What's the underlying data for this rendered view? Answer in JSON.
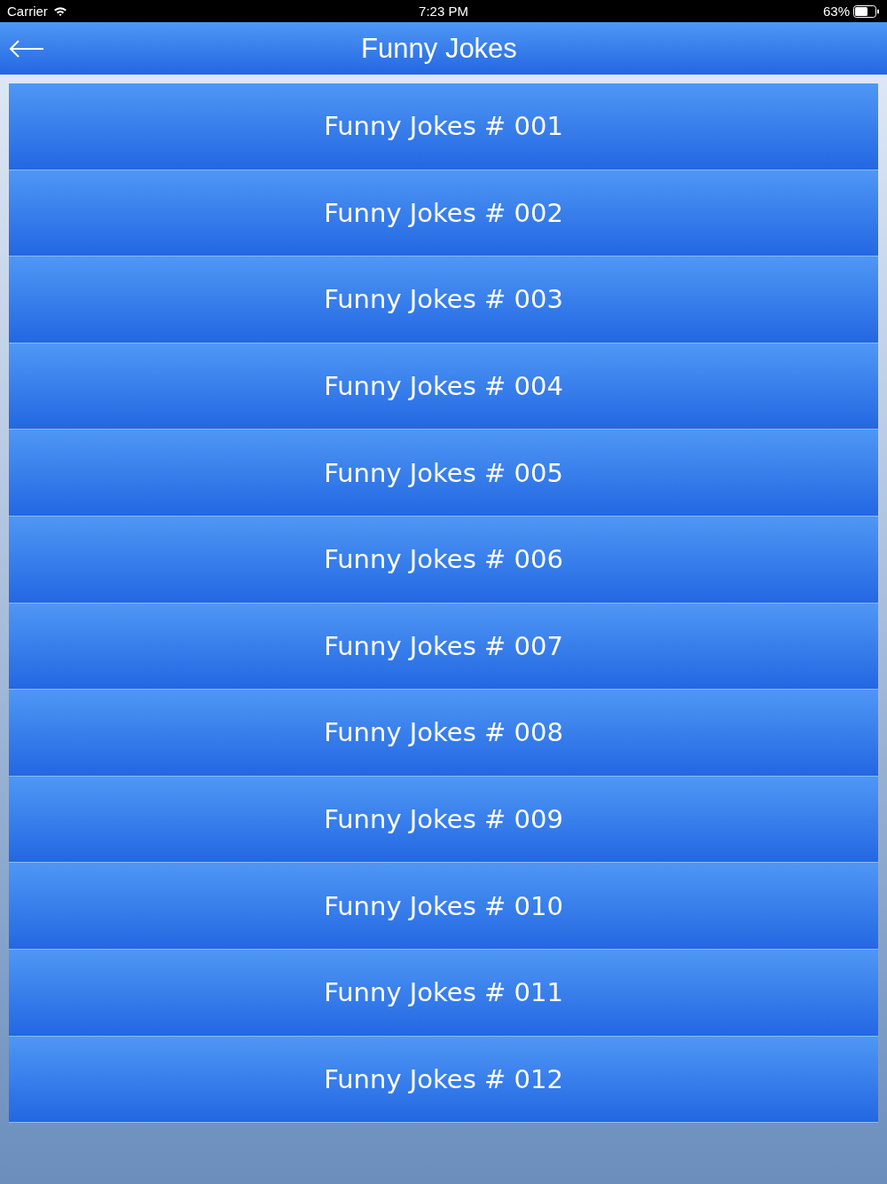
{
  "status_bar": {
    "carrier": "Carrier",
    "time": "7:23 PM",
    "battery": "63%"
  },
  "nav_bar": {
    "title": "Funny Jokes"
  },
  "jokes": [
    {
      "label": "Funny Jokes # 001"
    },
    {
      "label": "Funny Jokes # 002"
    },
    {
      "label": "Funny Jokes # 003"
    },
    {
      "label": "Funny Jokes # 004"
    },
    {
      "label": "Funny Jokes # 005"
    },
    {
      "label": "Funny Jokes # 006"
    },
    {
      "label": "Funny Jokes # 007"
    },
    {
      "label": "Funny Jokes # 008"
    },
    {
      "label": "Funny Jokes # 009"
    },
    {
      "label": "Funny Jokes # 010"
    },
    {
      "label": "Funny Jokes # 011"
    },
    {
      "label": "Funny Jokes # 012"
    }
  ]
}
